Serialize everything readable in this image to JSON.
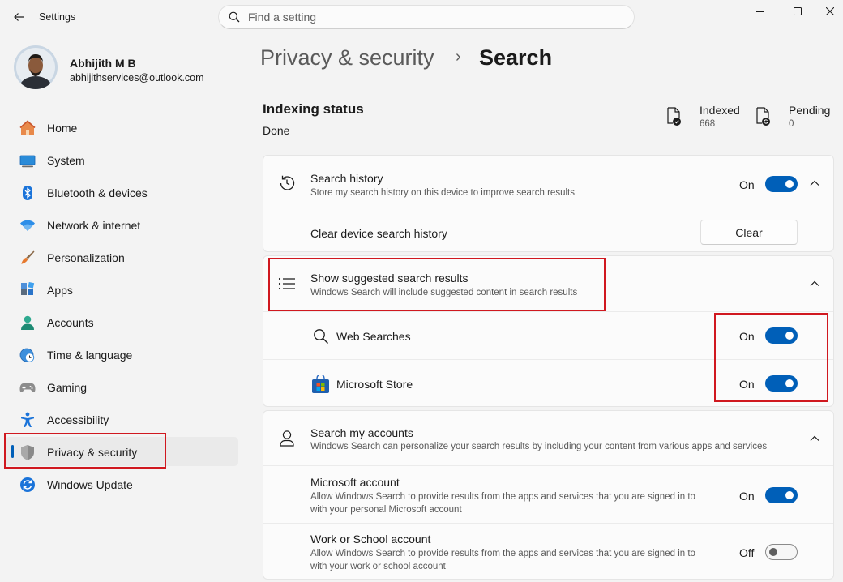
{
  "app": {
    "title": "Settings"
  },
  "search": {
    "placeholder": "Find a setting"
  },
  "user": {
    "name": "Abhijith M B",
    "email": "abhijithservices@outlook.com"
  },
  "sidebar": {
    "items": [
      {
        "label": "Home",
        "icon": "home-icon"
      },
      {
        "label": "System",
        "icon": "system-icon"
      },
      {
        "label": "Bluetooth & devices",
        "icon": "bluetooth-icon"
      },
      {
        "label": "Network & internet",
        "icon": "wifi-icon"
      },
      {
        "label": "Personalization",
        "icon": "brush-icon"
      },
      {
        "label": "Apps",
        "icon": "apps-icon"
      },
      {
        "label": "Accounts",
        "icon": "accounts-icon"
      },
      {
        "label": "Time & language",
        "icon": "globe-clock-icon"
      },
      {
        "label": "Gaming",
        "icon": "gamepad-icon"
      },
      {
        "label": "Accessibility",
        "icon": "accessibility-icon"
      },
      {
        "label": "Privacy & security",
        "icon": "shield-icon",
        "active": true
      },
      {
        "label": "Windows Update",
        "icon": "update-icon"
      }
    ]
  },
  "breadcrumb": {
    "parent": "Privacy & security",
    "separator": "›",
    "current": "Search"
  },
  "indexing": {
    "title": "Indexing status",
    "state": "Done",
    "indexed_label": "Indexed",
    "indexed_value": "668",
    "pending_label": "Pending",
    "pending_value": "0"
  },
  "search_history": {
    "title": "Search history",
    "desc": "Store my search history on this device to improve search results",
    "state": "On",
    "enabled": true,
    "clear_label": "Clear device search history",
    "clear_button": "Clear"
  },
  "suggested": {
    "title": "Show suggested search results",
    "desc": "Windows Search will include suggested content in search results",
    "web_label": "Web Searches",
    "web_state": "On",
    "web_enabled": true,
    "store_label": "Microsoft Store",
    "store_state": "On",
    "store_enabled": true
  },
  "accounts": {
    "title": "Search my accounts",
    "desc": "Windows Search can personalize your search results by including your content from various apps and services",
    "ms_title": "Microsoft account",
    "ms_desc_1": "Allow Windows Search to provide results from the apps and services that you are signed in to",
    "ms_desc_2": "with your personal Microsoft account",
    "ms_state": "On",
    "ms_enabled": true,
    "work_title": "Work or School account",
    "work_desc_1": "Allow Windows Search to provide results from the apps and services that you are signed in to",
    "work_desc_2": "with your work or school account",
    "work_state": "Off",
    "work_enabled": false
  },
  "colors": {
    "accent": "#005fb8",
    "highlight": "#d0181f",
    "background": "#f3f3f3",
    "card": "#fbfbfb"
  }
}
